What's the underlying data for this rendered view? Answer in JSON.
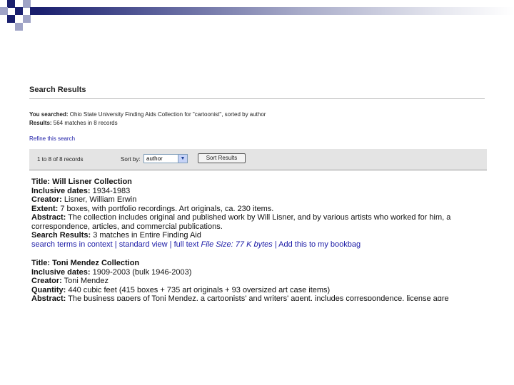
{
  "results": {
    "heading": "Search Results",
    "searched_label": "You searched:",
    "searched_value": " Ohio State University Finding Aids Collection for \"cartoonist\", sorted by author",
    "results_label": "Results:",
    "results_value": " 564 matches in 8 records",
    "refine_link": "Refine this search"
  },
  "toolbar": {
    "record_count": "1 to 8 of 8 records",
    "sort_label": "Sort by:",
    "sort_value": "author",
    "sort_button": "Sort Results"
  },
  "records": [
    {
      "title_label": "Title:",
      "title": " Will Lisner Collection",
      "dates_label": "Inclusive dates:",
      "dates": " 1934-1983",
      "creator_label": "Creator:",
      "creator": " Lisner, William Erwin",
      "extent_label": "Extent:",
      "extent": " 7 boxes, with portfolio recordings. Art originals, ca. 230 items.",
      "abstract_label": "Abstract:",
      "abstract": " The collection includes original and published work by Will Lisner, and by various artists who worked for him, a",
      "abstract_cont": "correspondence, articles, and commercial publications.",
      "search_label": "Search Results:",
      "search_value": " 3  matches in Entire Finding Aid",
      "link_context": "search terms in context",
      "link_standard": "standard view",
      "link_full": "full text",
      "file_size": "File Size: 77 K bytes",
      "link_bookbag": "Add this to my bookbag"
    },
    {
      "title_label": "Title:",
      "title": " Toni Mendez Collection",
      "dates_label": "Inclusive dates:",
      "dates": " 1909-2003  (bulk 1946-2003)",
      "creator_label": "Creator:",
      "creator": " Toni Mendez",
      "quantity_label": "Quantity:",
      "quantity": " 440 cubic feet (415 boxes + 735 art originals + 93 oversized art case items)",
      "abstract_label": "Abstract:",
      "abstract": " The business papers of Toni Mendez, a cartoonists' and writers' agent, includes correspondence, license agre"
    }
  ]
}
